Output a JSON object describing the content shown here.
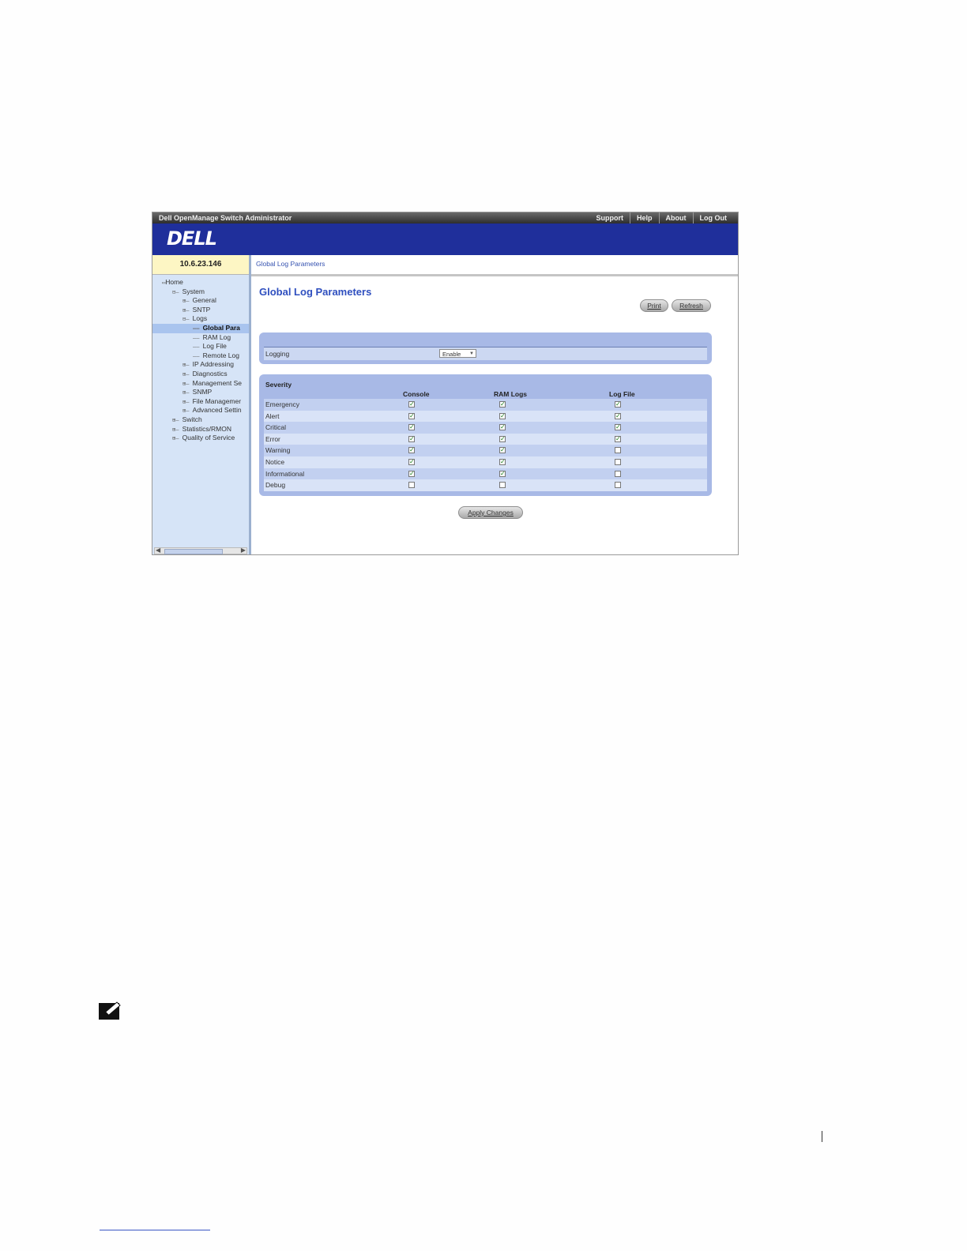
{
  "titlebar": {
    "app": "Dell OpenManage Switch Administrator",
    "links": [
      "Support",
      "Help",
      "About",
      "Log Out"
    ]
  },
  "brand": {
    "logo": "DELL"
  },
  "sidebar": {
    "ip": "10.6.23.146",
    "tree": [
      {
        "label": "Home",
        "indent": 0,
        "exp": ""
      },
      {
        "label": "System",
        "indent": 1,
        "exp": "⊟"
      },
      {
        "label": "General",
        "indent": 2,
        "exp": "⊞"
      },
      {
        "label": "SNTP",
        "indent": 2,
        "exp": "⊞"
      },
      {
        "label": "Logs",
        "indent": 2,
        "exp": "⊟"
      },
      {
        "label": "Global Para",
        "indent": 3,
        "exp": "",
        "selected": true
      },
      {
        "label": "RAM Log",
        "indent": 3,
        "exp": ""
      },
      {
        "label": "Log File",
        "indent": 3,
        "exp": ""
      },
      {
        "label": "Remote Log",
        "indent": 3,
        "exp": ""
      },
      {
        "label": "IP Addressing",
        "indent": 2,
        "exp": "⊞"
      },
      {
        "label": "Diagnostics",
        "indent": 2,
        "exp": "⊞"
      },
      {
        "label": "Management Se",
        "indent": 2,
        "exp": "⊞"
      },
      {
        "label": "SNMP",
        "indent": 2,
        "exp": "⊞"
      },
      {
        "label": "File Managemer",
        "indent": 2,
        "exp": "⊞"
      },
      {
        "label": "Advanced Settin",
        "indent": 2,
        "exp": "⊞"
      },
      {
        "label": "Switch",
        "indent": 1,
        "exp": "⊞"
      },
      {
        "label": "Statistics/RMON",
        "indent": 1,
        "exp": "⊞"
      },
      {
        "label": "Quality of Service",
        "indent": 1,
        "exp": "⊞"
      }
    ]
  },
  "breadcrumb": "Global Log Parameters",
  "page": {
    "title": "Global Log Parameters",
    "print_label": "Print",
    "refresh_label": "Refresh",
    "logging_label": "Logging",
    "logging_value": "Enable",
    "apply_label": "Apply Changes"
  },
  "severity": {
    "heading": "Severity",
    "columns": [
      "Console",
      "RAM Logs",
      "Log File"
    ],
    "rows": [
      {
        "name": "Emergency",
        "values": [
          true,
          true,
          true
        ]
      },
      {
        "name": "Alert",
        "values": [
          true,
          true,
          true
        ]
      },
      {
        "name": "Critical",
        "values": [
          true,
          true,
          true
        ]
      },
      {
        "name": "Error",
        "values": [
          true,
          true,
          true
        ]
      },
      {
        "name": "Warning",
        "values": [
          true,
          true,
          false
        ]
      },
      {
        "name": "Notice",
        "values": [
          true,
          true,
          false
        ]
      },
      {
        "name": "Informational",
        "values": [
          true,
          true,
          false
        ]
      },
      {
        "name": "Debug",
        "values": [
          false,
          false,
          false
        ]
      }
    ]
  }
}
